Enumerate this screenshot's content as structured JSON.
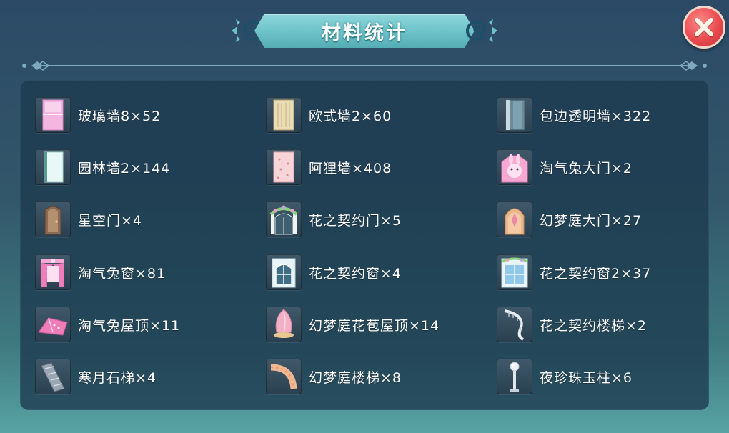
{
  "title": "材料统计",
  "colors": {
    "accent": "#6cc2c8",
    "close": "#e84b4f",
    "panel": "#1c3a4e"
  },
  "close_icon": "close-x-icon",
  "items": [
    {
      "label": "玻璃墙8×52",
      "icon": "glass-wall-icon"
    },
    {
      "label": "欧式墙2×60",
      "icon": "european-wall-icon"
    },
    {
      "label": "包边透明墙×322",
      "icon": "edged-transparent-wall-icon"
    },
    {
      "label": "园林墙2×144",
      "icon": "garden-wall-icon"
    },
    {
      "label": "阿狸墙×408",
      "icon": "ali-wall-icon"
    },
    {
      "label": "淘气兔大门×2",
      "icon": "bunny-gate-icon"
    },
    {
      "label": "星空门×4",
      "icon": "starry-door-icon"
    },
    {
      "label": "花之契约门×5",
      "icon": "flower-pact-door-icon"
    },
    {
      "label": "幻梦庭大门×27",
      "icon": "dream-court-gate-icon"
    },
    {
      "label": "淘气兔窗×81",
      "icon": "bunny-window-icon"
    },
    {
      "label": "花之契约窗×4",
      "icon": "flower-pact-window-icon"
    },
    {
      "label": "花之契约窗2×37",
      "icon": "flower-pact-window2-icon"
    },
    {
      "label": "淘气兔屋顶×11",
      "icon": "bunny-roof-icon"
    },
    {
      "label": "幻梦庭花苞屋顶×14",
      "icon": "dream-bud-roof-icon"
    },
    {
      "label": "花之契约楼梯×2",
      "icon": "flower-pact-stairs-icon"
    },
    {
      "label": "寒月石梯×4",
      "icon": "cold-moon-stone-stairs-icon"
    },
    {
      "label": "幻梦庭楼梯×8",
      "icon": "dream-court-stairs-icon"
    },
    {
      "label": "夜珍珠玉柱×6",
      "icon": "night-pearl-pillar-icon"
    }
  ]
}
